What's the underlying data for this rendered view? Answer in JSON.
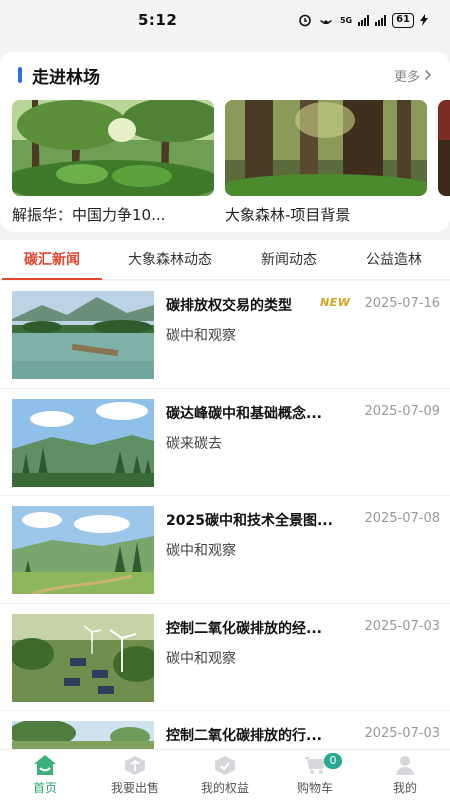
{
  "status_bar": {
    "time": "5:12",
    "battery": "61",
    "network": "5G"
  },
  "forest_section": {
    "title": "走进林场",
    "more_label": "更多",
    "items": [
      {
        "label": "解振华：中国力争10..."
      },
      {
        "label": "大象森林-项目背景"
      }
    ]
  },
  "tabs": [
    {
      "label": "碳汇新闻",
      "active": true
    },
    {
      "label": "大象森林动态",
      "active": false
    },
    {
      "label": "新闻动态",
      "active": false
    },
    {
      "label": "公益造林",
      "active": false
    }
  ],
  "news": [
    {
      "title": "碳排放权交易的类型",
      "badge": "NEW",
      "date": "2025-07-16",
      "source": "碳中和观察"
    },
    {
      "title": "碳达峰碳中和基础概念...",
      "badge": "",
      "date": "2025-07-09",
      "source": "碳来碳去"
    },
    {
      "title": "2025碳中和技术全景图...",
      "badge": "",
      "date": "2025-07-08",
      "source": "碳中和观察"
    },
    {
      "title": "控制二氧化碳排放的经...",
      "badge": "",
      "date": "2025-07-03",
      "source": "碳中和观察"
    },
    {
      "title": "控制二氧化碳排放的行...",
      "badge": "",
      "date": "2025-07-03",
      "source": ""
    }
  ],
  "bottom_nav": [
    {
      "label": "首页",
      "icon": "home-icon",
      "active": true
    },
    {
      "label": "我要出售",
      "icon": "sell-icon",
      "active": false
    },
    {
      "label": "我的权益",
      "icon": "rights-icon",
      "active": false
    },
    {
      "label": "购物车",
      "icon": "cart-icon",
      "active": false,
      "badge": "0"
    },
    {
      "label": "我的",
      "icon": "profile-icon",
      "active": false
    }
  ],
  "colors": {
    "accent_red": "#e0452f",
    "accent_blue": "#2f6fe8",
    "nav_green": "#2ba56d"
  }
}
